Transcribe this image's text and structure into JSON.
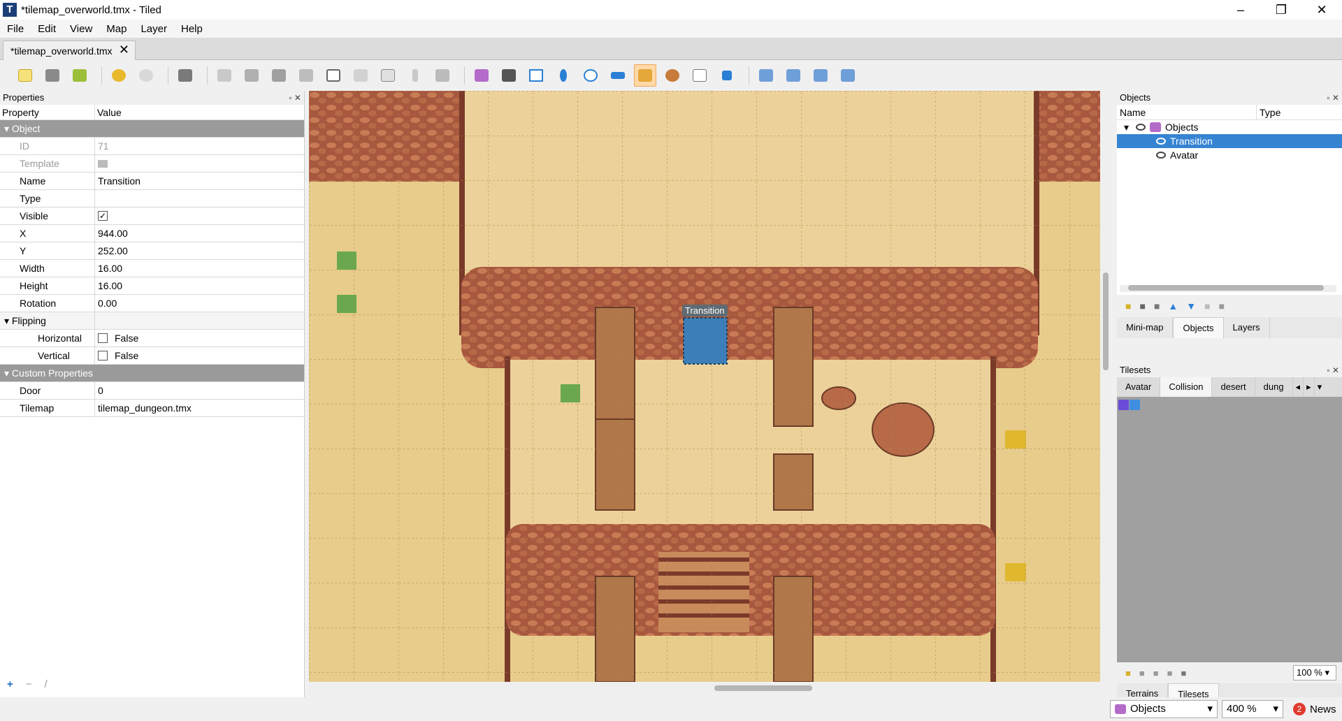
{
  "window": {
    "title": "*tilemap_overworld.tmx - Tiled",
    "minimize": "–",
    "maximize": "❐",
    "close": "✕"
  },
  "menu": [
    "File",
    "Edit",
    "View",
    "Map",
    "Layer",
    "Help"
  ],
  "document_tab": {
    "label": "*tilemap_overworld.tmx",
    "close": "✕"
  },
  "toolbar": {
    "icons": [
      "new-map-icon",
      "open-icon",
      "save-icon",
      "undo-icon",
      "redo-icon",
      "commands-icon",
      "stamp-brush-icon",
      "terrain-brush-icon",
      "wang-brush-icon",
      "bucket-fill-icon",
      "shape-fill-icon",
      "eraser-icon",
      "rect-select-icon",
      "magic-wand-icon",
      "select-same-tile-icon",
      "select-objects-icon",
      "edit-polygons-icon",
      "insert-rectangle-icon",
      "insert-point-icon",
      "insert-ellipse-icon",
      "insert-polygon-icon",
      "insert-tile-icon",
      "insert-template-icon",
      "insert-text-icon",
      "move-icon",
      "flip-horizontal-icon",
      "flip-vertical-icon",
      "rotate-left-icon",
      "rotate-right-icon"
    ],
    "active": "insert-tile-icon"
  },
  "properties": {
    "panel_title": "Properties",
    "col_property": "Property",
    "col_value": "Value",
    "group_object": "Object",
    "id_label": "ID",
    "id_value": "71",
    "template_label": "Template",
    "name_label": "Name",
    "name_value": "Transition",
    "type_label": "Type",
    "type_value": "",
    "visible_label": "Visible",
    "visible_check": "✓",
    "x_label": "X",
    "x_value": "944.00",
    "y_label": "Y",
    "y_value": "252.00",
    "width_label": "Width",
    "width_value": "16.00",
    "height_label": "Height",
    "height_value": "16.00",
    "rotation_label": "Rotation",
    "rotation_value": "0.00",
    "group_flipping": "Flipping",
    "horizontal_label": "Horizontal",
    "horizontal_value": "False",
    "vertical_label": "Vertical",
    "vertical_value": "False",
    "group_custom": "Custom Properties",
    "door_label": "Door",
    "door_value": "0",
    "tilemap_label": "Tilemap",
    "tilemap_value": "tilemap_dungeon.tmx",
    "add": "+",
    "remove": "−",
    "rename": "/"
  },
  "map": {
    "object_label": "Transition"
  },
  "objects_panel": {
    "title": "Objects",
    "col_name": "Name",
    "col_type": "Type",
    "layer_name": "Objects",
    "items": [
      "Transition",
      "Avatar"
    ],
    "selected": "Transition",
    "tabs": [
      "Mini-map",
      "Objects",
      "Layers"
    ],
    "active_tab": "Objects"
  },
  "tilesets_panel": {
    "title": "Tilesets",
    "tabs": [
      "Avatar",
      "Collision",
      "desert",
      "dung"
    ],
    "active_tab": "Collision",
    "zoom": "100 %",
    "bottom_tabs": [
      "Terrains",
      "Tilesets"
    ],
    "active_bottom_tab": "Tilesets"
  },
  "statusbar": {
    "layer": "Objects",
    "zoom": "400 %",
    "news_count": "2",
    "news": "News"
  },
  "colors": {
    "selection": "#3584d2",
    "transition_object": "#3c7fb8",
    "sand": "#e8cc8c",
    "rock": "#a7583e"
  }
}
